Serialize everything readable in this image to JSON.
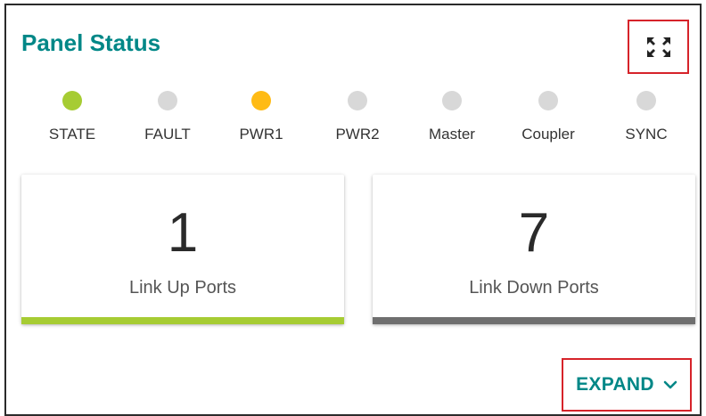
{
  "panel": {
    "title": "Panel Status",
    "fullscreen_icon": "fullscreen-icon"
  },
  "leds": [
    {
      "label": "STATE",
      "color": "#a6cc33"
    },
    {
      "label": "FAULT",
      "color": "#d8d8d8"
    },
    {
      "label": "PWR1",
      "color": "#ffbb15"
    },
    {
      "label": "PWR2",
      "color": "#d8d8d8"
    },
    {
      "label": "Master",
      "color": "#d8d8d8"
    },
    {
      "label": "Coupler",
      "color": "#d8d8d8"
    },
    {
      "label": "SYNC",
      "color": "#d8d8d8"
    }
  ],
  "cards": [
    {
      "value": "1",
      "caption": "Link Up Ports",
      "bar_color": "#a6cc33"
    },
    {
      "value": "7",
      "caption": "Link Down Ports",
      "bar_color": "#6f6f6f"
    }
  ],
  "expand": {
    "label": "EXPAND",
    "icon": "chevron-down-icon"
  },
  "colors": {
    "accent": "#008787",
    "highlight_border": "#d6232a"
  }
}
